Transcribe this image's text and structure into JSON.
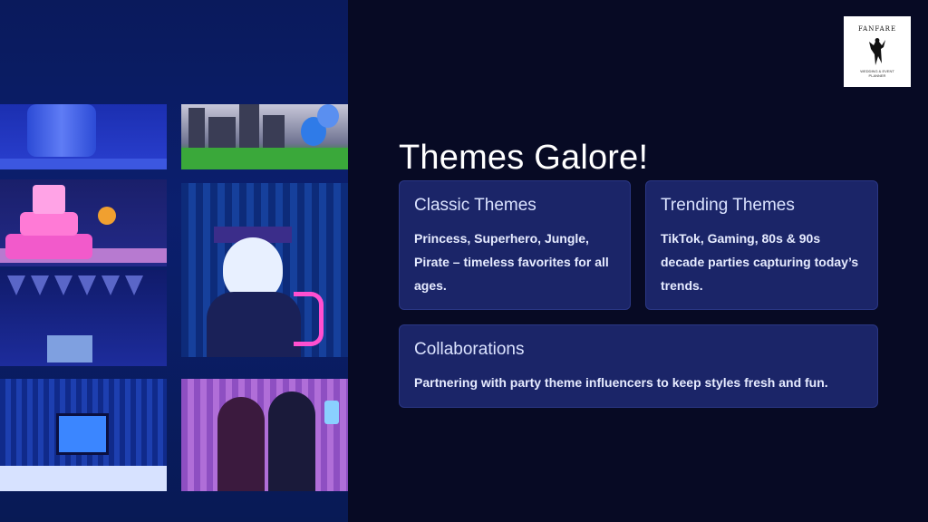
{
  "logo": {
    "name": "FANFARE",
    "subtitle_line1": "WEDDING & EVENT",
    "subtitle_line2": "PLANNER"
  },
  "slide": {
    "title": "Themes Galore!"
  },
  "cards": [
    {
      "title": "Classic Themes",
      "body": "Princess, Superhero, Jungle, Pirate – timeless favorites for all ages."
    },
    {
      "title": "Trending Themes",
      "body": "TikTok, Gaming, 80s & 90s decade parties capturing today’s trends."
    },
    {
      "title": "Collaborations",
      "body": "Partnering with party theme influencers to keep styles fresh and fun."
    }
  ],
  "colors": {
    "background": "#070a24",
    "card_background": "#1b2568",
    "title_text": "#ffffff"
  }
}
